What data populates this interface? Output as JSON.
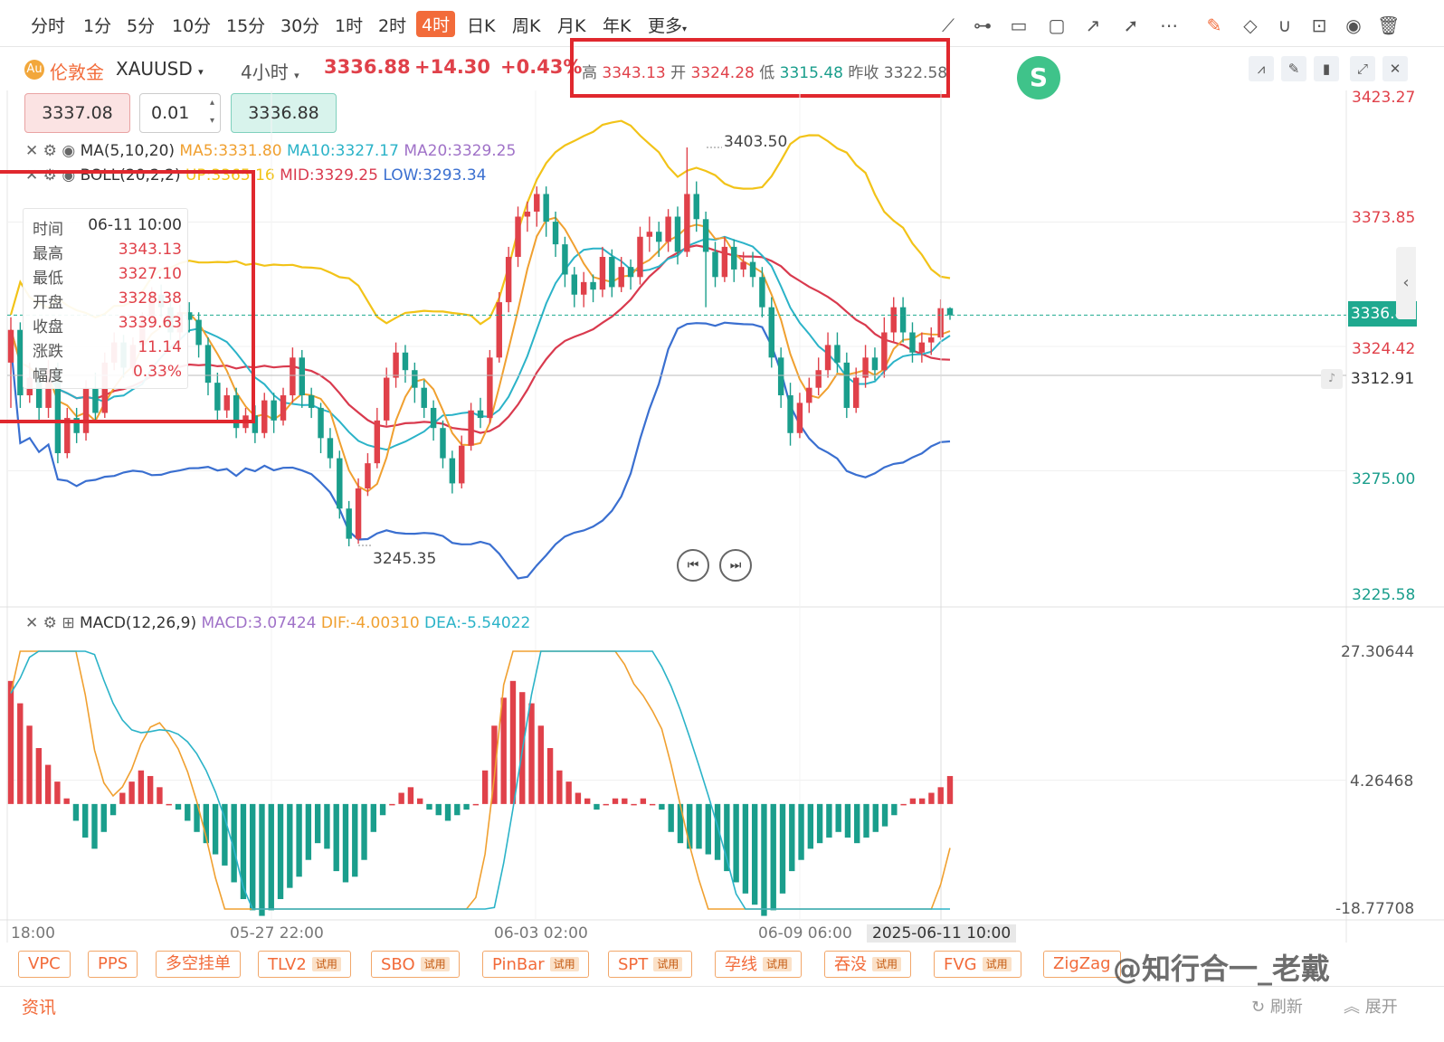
{
  "toolbar": {
    "timeframes": [
      "分时",
      "1分",
      "5分",
      "10分",
      "15分",
      "30分",
      "1时",
      "2时",
      "4时",
      "日K",
      "周K",
      "月K",
      "年K",
      "更多"
    ],
    "active_timeframe": "4时"
  },
  "symbol": {
    "name": "伦敦金",
    "code": "XAUUSD",
    "period": "4小时",
    "price": "3336.88",
    "change": "+14.30",
    "change_pct": "+0.43%"
  },
  "ohlc": {
    "high_label": "高",
    "high": "3343.13",
    "open_label": "开",
    "open": "3324.28",
    "low_label": "低",
    "low": "3315.48",
    "prev_label": "昨收",
    "prev": "3322.58"
  },
  "trade": {
    "sell": "3337.08",
    "qty": "0.01",
    "buy": "3336.88"
  },
  "ma": {
    "label": "MA(5,10,20)",
    "ma5": "MA5:3331.80",
    "ma10": "MA10:3327.17",
    "ma20": "MA20:3329.25"
  },
  "boll": {
    "label": "BOLL(20,2,2)",
    "up": "UP:3365.16",
    "mid": "MID:3329.25",
    "low": "LOW:3293.34"
  },
  "tooltip": {
    "time_label": "时间",
    "time": "06-11 10:00",
    "high_label": "最高",
    "high": "3343.13",
    "low_label": "最低",
    "low": "3327.10",
    "open_label": "开盘",
    "open": "3328.38",
    "close_label": "收盘",
    "close": "3339.63",
    "chg_label": "涨跌",
    "chg": "11.14",
    "amp_label": "幅度",
    "amp": "0.33%"
  },
  "macd": {
    "label": "MACD(12,26,9)",
    "macd": "MACD:3.07424",
    "dif": "DIF:-4.00310",
    "dea": "DEA:-5.54022"
  },
  "price_axis": [
    "3423.27",
    "3373.85",
    "3324.42",
    "3275.00",
    "3225.58"
  ],
  "current_price_tag": "3336.88",
  "crosshair_price_tag": "3312.91",
  "macd_axis": [
    "27.30644",
    "4.26468",
    "-18.77708"
  ],
  "time_axis": [
    "18:00",
    "05-27 22:00",
    "06-03 02:00",
    "06-09 06:00"
  ],
  "crosshair_time": "2025-06-11 10:00",
  "annotations": {
    "high": "3403.50",
    "low": "3245.35"
  },
  "plugins": [
    {
      "name": "VPC",
      "trial": ""
    },
    {
      "name": "PPS",
      "trial": ""
    },
    {
      "name": "多空挂单",
      "trial": ""
    },
    {
      "name": "TLV2",
      "trial": "试用"
    },
    {
      "name": "SBO",
      "trial": "试用"
    },
    {
      "name": "PinBar",
      "trial": "试用"
    },
    {
      "name": "SPT",
      "trial": "试用"
    },
    {
      "name": "孕线",
      "trial": "试用"
    },
    {
      "name": "吞没",
      "trial": "试用"
    },
    {
      "name": "FVG",
      "trial": "试用"
    },
    {
      "name": "ZigZag",
      "trial": ""
    }
  ],
  "footer": {
    "news": "资讯",
    "refresh": "刷新",
    "expand": "展开"
  },
  "watermark": "@知行合一_老戴",
  "colors": {
    "up": "#e0414a",
    "down": "#1a9e8c",
    "ma5": "#f0a030",
    "ma10": "#2bb3c8",
    "ma20": "#d93a4e",
    "boll_up": "#f2c318",
    "boll_low": "#3a6fd0",
    "accent": "#f26b3a"
  },
  "chart_data": {
    "type": "candlestick",
    "interval": "4h",
    "symbol": "XAUUSD",
    "price_range": [
      3225.58,
      3423.27
    ],
    "macd_range": [
      -18.77708,
      27.30644
    ],
    "candles_approx": [
      [
        3318,
        3331,
        3300,
        3336
      ],
      [
        3331,
        3305,
        3300,
        3334
      ],
      [
        3305,
        3312,
        3302,
        3318
      ],
      [
        3312,
        3300,
        3295,
        3316
      ],
      [
        3300,
        3315,
        3296,
        3319
      ],
      [
        3315,
        3282,
        3278,
        3318
      ],
      [
        3282,
        3296,
        3280,
        3300
      ],
      [
        3296,
        3290,
        3286,
        3300
      ],
      [
        3290,
        3308,
        3287,
        3311
      ],
      [
        3308,
        3298,
        3294,
        3314
      ],
      [
        3298,
        3318,
        3296,
        3322
      ],
      [
        3318,
        3326,
        3315,
        3330
      ],
      [
        3326,
        3316,
        3312,
        3329
      ],
      [
        3316,
        3325,
        3313,
        3328
      ],
      [
        3325,
        3335,
        3322,
        3338
      ],
      [
        3335,
        3345,
        3332,
        3348
      ],
      [
        3345,
        3340,
        3336,
        3349
      ],
      [
        3340,
        3330,
        3327,
        3343
      ],
      [
        3330,
        3338,
        3327,
        3341
      ],
      [
        3338,
        3335,
        3330,
        3342
      ],
      [
        3335,
        3325,
        3320,
        3338
      ],
      [
        3325,
        3310,
        3305,
        3328
      ],
      [
        3310,
        3299,
        3295,
        3314
      ],
      [
        3299,
        3305,
        3296,
        3308
      ],
      [
        3305,
        3292,
        3288,
        3308
      ],
      [
        3292,
        3297,
        3290,
        3300
      ],
      [
        3297,
        3290,
        3286,
        3301
      ],
      [
        3290,
        3303,
        3288,
        3306
      ],
      [
        3303,
        3295,
        3290,
        3306
      ],
      [
        3295,
        3305,
        3293,
        3308
      ],
      [
        3305,
        3320,
        3302,
        3324
      ],
      [
        3320,
        3305,
        3300,
        3323
      ],
      [
        3305,
        3300,
        3296,
        3308
      ],
      [
        3300,
        3288,
        3282,
        3302
      ],
      [
        3288,
        3280,
        3276,
        3292
      ],
      [
        3280,
        3260,
        3256,
        3283
      ],
      [
        3260,
        3248,
        3245,
        3263
      ],
      [
        3248,
        3268,
        3246,
        3272
      ],
      [
        3268,
        3278,
        3265,
        3282
      ],
      [
        3278,
        3295,
        3276,
        3300
      ],
      [
        3295,
        3312,
        3293,
        3316
      ],
      [
        3312,
        3322,
        3308,
        3326
      ],
      [
        3322,
        3315,
        3310,
        3325
      ],
      [
        3315,
        3308,
        3302,
        3318
      ],
      [
        3308,
        3300,
        3296,
        3311
      ],
      [
        3300,
        3292,
        3287,
        3303
      ],
      [
        3292,
        3280,
        3276,
        3295
      ],
      [
        3280,
        3270,
        3266,
        3283
      ],
      [
        3270,
        3285,
        3268,
        3289
      ],
      [
        3285,
        3299,
        3283,
        3302
      ],
      [
        3299,
        3296,
        3292,
        3304
      ],
      [
        3296,
        3320,
        3294,
        3323
      ],
      [
        3320,
        3342,
        3318,
        3346
      ],
      [
        3342,
        3360,
        3338,
        3364
      ],
      [
        3360,
        3376,
        3356,
        3380
      ],
      [
        3376,
        3378,
        3370,
        3382
      ],
      [
        3378,
        3385,
        3372,
        3388
      ],
      [
        3385,
        3374,
        3368,
        3388
      ],
      [
        3374,
        3365,
        3360,
        3378
      ],
      [
        3365,
        3353,
        3348,
        3368
      ],
      [
        3353,
        3345,
        3340,
        3356
      ],
      [
        3345,
        3350,
        3340,
        3354
      ],
      [
        3350,
        3347,
        3342,
        3353
      ],
      [
        3347,
        3360,
        3344,
        3364
      ],
      [
        3360,
        3348,
        3344,
        3363
      ],
      [
        3348,
        3356,
        3346,
        3360
      ],
      [
        3356,
        3352,
        3347,
        3359
      ],
      [
        3352,
        3368,
        3349,
        3372
      ],
      [
        3368,
        3370,
        3362,
        3376
      ],
      [
        3370,
        3366,
        3360,
        3374
      ],
      [
        3366,
        3376,
        3362,
        3379
      ],
      [
        3376,
        3362,
        3357,
        3380
      ],
      [
        3362,
        3385,
        3360,
        3403.5
      ],
      [
        3385,
        3375,
        3370,
        3390
      ],
      [
        3375,
        3362,
        3340,
        3378
      ],
      [
        3362,
        3352,
        3348,
        3366
      ],
      [
        3352,
        3364,
        3350,
        3368
      ],
      [
        3364,
        3355,
        3350,
        3367
      ],
      [
        3355,
        3358,
        3352,
        3362
      ],
      [
        3358,
        3352,
        3348,
        3362
      ],
      [
        3352,
        3340,
        3336,
        3356
      ],
      [
        3340,
        3320,
        3316,
        3344
      ],
      [
        3320,
        3305,
        3300,
        3324
      ],
      [
        3305,
        3290,
        3285,
        3310
      ],
      [
        3290,
        3302,
        3288,
        3306
      ],
      [
        3302,
        3308,
        3298,
        3312
      ],
      [
        3308,
        3315,
        3305,
        3320
      ],
      [
        3315,
        3325,
        3312,
        3330
      ],
      [
        3325,
        3318,
        3314,
        3330
      ],
      [
        3318,
        3300,
        3296,
        3322
      ],
      [
        3300,
        3312,
        3298,
        3316
      ],
      [
        3312,
        3320,
        3308,
        3325
      ],
      [
        3320,
        3315,
        3311,
        3324
      ],
      [
        3315,
        3330,
        3312,
        3336
      ],
      [
        3330,
        3340,
        3326,
        3344
      ],
      [
        3340,
        3330,
        3326,
        3344
      ],
      [
        3330,
        3322,
        3318,
        3334
      ],
      [
        3322,
        3326,
        3318,
        3330
      ],
      [
        3326,
        3328,
        3321,
        3332
      ],
      [
        3328,
        3339.63,
        3327.1,
        3343.13
      ],
      [
        3339.63,
        3336.88,
        3335,
        3340
      ]
    ],
    "macd_hist_approx": [
      22,
      18,
      14,
      10,
      7,
      4,
      1,
      -3,
      -6,
      -8,
      -5,
      -2,
      2,
      4,
      6,
      5,
      3,
      0,
      -1,
      -3,
      -5,
      -7,
      -9,
      -11,
      -14,
      -17,
      -19,
      -20,
      -19,
      -17,
      -15,
      -13,
      -10,
      -7,
      -8,
      -12,
      -14,
      -13,
      -10,
      -5,
      -2,
      0,
      2,
      3,
      1,
      -1,
      -2,
      -3,
      -2,
      -1,
      0,
      6,
      14,
      19,
      22,
      20,
      18,
      14,
      10,
      6,
      4,
      2,
      1,
      -1,
      0,
      1,
      1,
      0,
      1,
      0,
      -1,
      -5,
      -7,
      -8,
      -8,
      -9,
      -10,
      -12,
      -14,
      -16,
      -18,
      -20,
      -19,
      -16,
      -12,
      -10,
      -8,
      -7,
      -6,
      -5,
      -6,
      -7,
      -6,
      -5,
      -4,
      -2,
      0,
      1,
      1,
      2,
      3,
      5
    ]
  }
}
